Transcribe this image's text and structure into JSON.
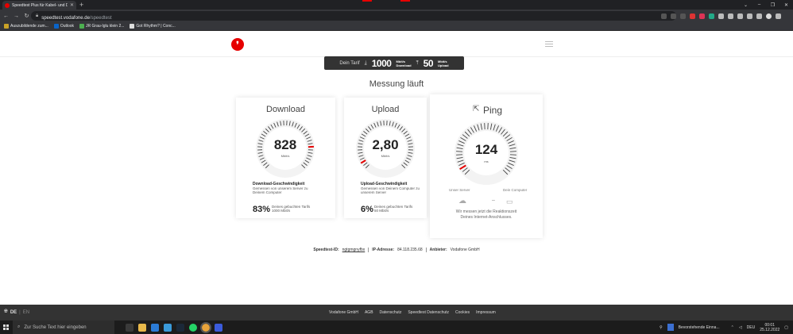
{
  "browser": {
    "tab_title": "Speedtest Plus für Kabel- und DS",
    "url_host": "speedtest.vodafone.de",
    "url_path": "/speedtest",
    "bookmarks": [
      {
        "label": "Auszubildende zum...",
        "color": "#c9a227"
      },
      {
        "label": "Outlook",
        "color": "#0a64c8"
      },
      {
        "label": "JR Grau-Iglu klein 2...",
        "color": "#4caf50"
      },
      {
        "label": "Got Rhythm? | Conc...",
        "color": "#dddddd"
      }
    ]
  },
  "colors": {
    "brand": "#e60000",
    "dark": "#333333"
  },
  "tarif": {
    "label": "Dein Tarif",
    "download_value": "1000",
    "download_unit_top": "Mbit/s",
    "download_unit_bottom": "Download",
    "upload_value": "50",
    "upload_unit_top": "Mbit/s",
    "upload_unit_bottom": "Upload"
  },
  "status": "Messung läuft",
  "download": {
    "title": "Download",
    "value": "828",
    "unit": "Mbit/s",
    "gauge_fraction": 0.83,
    "heading": "Download-Geschwindigkeit",
    "desc": "Gemessen von unserem Server zu Deinem Computer",
    "percent": "83%",
    "percent_desc_1": "Deines gebuchten Tarifs",
    "percent_desc_2": "1000 Mbit/s"
  },
  "upload": {
    "title": "Upload",
    "value": "2,80",
    "unit": "Mbit/s",
    "gauge_fraction": 0.06,
    "heading": "Upload-Geschwindigkeit",
    "desc": "Gemessen von Deinem Computer zu unserem Server",
    "percent": "6%",
    "percent_desc_1": "Deines gebuchten Tarifs",
    "percent_desc_2": "50 Mbit/s"
  },
  "ping": {
    "title": "Ping",
    "value": "124",
    "unit": "ms",
    "gauge_fraction": 0.06,
    "server_label": "Unser Server",
    "computer_label": "Dein Computer",
    "desc_1": "Wir messen jetzt die Reaktionszeit",
    "desc_2": "Deines Internet-Anschlusses."
  },
  "info": {
    "id_label": "Speedtest-ID:",
    "id_value": "ngtgmgnyfbx",
    "ip_label": "IP-Adresse:",
    "ip_value": "84.118.235.68",
    "provider_label": "Anbieter:",
    "provider_value": "Vodafone GmbH"
  },
  "footer": {
    "lang_active": "DE",
    "lang_other": "EN",
    "links": [
      "Vodafone GmbH",
      "AGB",
      "Datenschutz",
      "Speedtest Datenschutz",
      "Cookies",
      "Impressum"
    ]
  },
  "taskbar": {
    "search_placeholder": "Zur Suche Text hier eingeben",
    "event": "Bevorstehende Einna...",
    "lang": "DEU",
    "time": "00:01",
    "date": "25.12.2022"
  }
}
